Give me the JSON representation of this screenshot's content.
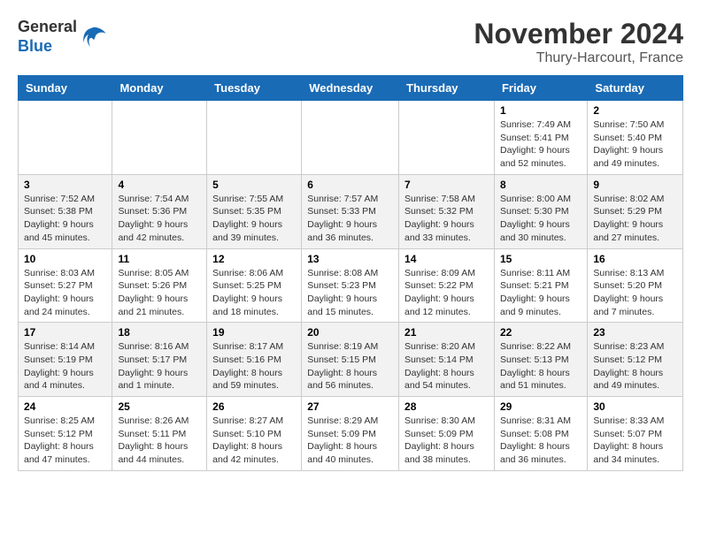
{
  "logo": {
    "line1": "General",
    "line2": "Blue"
  },
  "title": "November 2024",
  "location": "Thury-Harcourt, France",
  "weekdays": [
    "Sunday",
    "Monday",
    "Tuesday",
    "Wednesday",
    "Thursday",
    "Friday",
    "Saturday"
  ],
  "weeks": [
    [
      {
        "day": "",
        "info": ""
      },
      {
        "day": "",
        "info": ""
      },
      {
        "day": "",
        "info": ""
      },
      {
        "day": "",
        "info": ""
      },
      {
        "day": "",
        "info": ""
      },
      {
        "day": "1",
        "info": "Sunrise: 7:49 AM\nSunset: 5:41 PM\nDaylight: 9 hours and 52 minutes."
      },
      {
        "day": "2",
        "info": "Sunrise: 7:50 AM\nSunset: 5:40 PM\nDaylight: 9 hours and 49 minutes."
      }
    ],
    [
      {
        "day": "3",
        "info": "Sunrise: 7:52 AM\nSunset: 5:38 PM\nDaylight: 9 hours and 45 minutes."
      },
      {
        "day": "4",
        "info": "Sunrise: 7:54 AM\nSunset: 5:36 PM\nDaylight: 9 hours and 42 minutes."
      },
      {
        "day": "5",
        "info": "Sunrise: 7:55 AM\nSunset: 5:35 PM\nDaylight: 9 hours and 39 minutes."
      },
      {
        "day": "6",
        "info": "Sunrise: 7:57 AM\nSunset: 5:33 PM\nDaylight: 9 hours and 36 minutes."
      },
      {
        "day": "7",
        "info": "Sunrise: 7:58 AM\nSunset: 5:32 PM\nDaylight: 9 hours and 33 minutes."
      },
      {
        "day": "8",
        "info": "Sunrise: 8:00 AM\nSunset: 5:30 PM\nDaylight: 9 hours and 30 minutes."
      },
      {
        "day": "9",
        "info": "Sunrise: 8:02 AM\nSunset: 5:29 PM\nDaylight: 9 hours and 27 minutes."
      }
    ],
    [
      {
        "day": "10",
        "info": "Sunrise: 8:03 AM\nSunset: 5:27 PM\nDaylight: 9 hours and 24 minutes."
      },
      {
        "day": "11",
        "info": "Sunrise: 8:05 AM\nSunset: 5:26 PM\nDaylight: 9 hours and 21 minutes."
      },
      {
        "day": "12",
        "info": "Sunrise: 8:06 AM\nSunset: 5:25 PM\nDaylight: 9 hours and 18 minutes."
      },
      {
        "day": "13",
        "info": "Sunrise: 8:08 AM\nSunset: 5:23 PM\nDaylight: 9 hours and 15 minutes."
      },
      {
        "day": "14",
        "info": "Sunrise: 8:09 AM\nSunset: 5:22 PM\nDaylight: 9 hours and 12 minutes."
      },
      {
        "day": "15",
        "info": "Sunrise: 8:11 AM\nSunset: 5:21 PM\nDaylight: 9 hours and 9 minutes."
      },
      {
        "day": "16",
        "info": "Sunrise: 8:13 AM\nSunset: 5:20 PM\nDaylight: 9 hours and 7 minutes."
      }
    ],
    [
      {
        "day": "17",
        "info": "Sunrise: 8:14 AM\nSunset: 5:19 PM\nDaylight: 9 hours and 4 minutes."
      },
      {
        "day": "18",
        "info": "Sunrise: 8:16 AM\nSunset: 5:17 PM\nDaylight: 9 hours and 1 minute."
      },
      {
        "day": "19",
        "info": "Sunrise: 8:17 AM\nSunset: 5:16 PM\nDaylight: 8 hours and 59 minutes."
      },
      {
        "day": "20",
        "info": "Sunrise: 8:19 AM\nSunset: 5:15 PM\nDaylight: 8 hours and 56 minutes."
      },
      {
        "day": "21",
        "info": "Sunrise: 8:20 AM\nSunset: 5:14 PM\nDaylight: 8 hours and 54 minutes."
      },
      {
        "day": "22",
        "info": "Sunrise: 8:22 AM\nSunset: 5:13 PM\nDaylight: 8 hours and 51 minutes."
      },
      {
        "day": "23",
        "info": "Sunrise: 8:23 AM\nSunset: 5:12 PM\nDaylight: 8 hours and 49 minutes."
      }
    ],
    [
      {
        "day": "24",
        "info": "Sunrise: 8:25 AM\nSunset: 5:12 PM\nDaylight: 8 hours and 47 minutes."
      },
      {
        "day": "25",
        "info": "Sunrise: 8:26 AM\nSunset: 5:11 PM\nDaylight: 8 hours and 44 minutes."
      },
      {
        "day": "26",
        "info": "Sunrise: 8:27 AM\nSunset: 5:10 PM\nDaylight: 8 hours and 42 minutes."
      },
      {
        "day": "27",
        "info": "Sunrise: 8:29 AM\nSunset: 5:09 PM\nDaylight: 8 hours and 40 minutes."
      },
      {
        "day": "28",
        "info": "Sunrise: 8:30 AM\nSunset: 5:09 PM\nDaylight: 8 hours and 38 minutes."
      },
      {
        "day": "29",
        "info": "Sunrise: 8:31 AM\nSunset: 5:08 PM\nDaylight: 8 hours and 36 minutes."
      },
      {
        "day": "30",
        "info": "Sunrise: 8:33 AM\nSunset: 5:07 PM\nDaylight: 8 hours and 34 minutes."
      }
    ]
  ]
}
